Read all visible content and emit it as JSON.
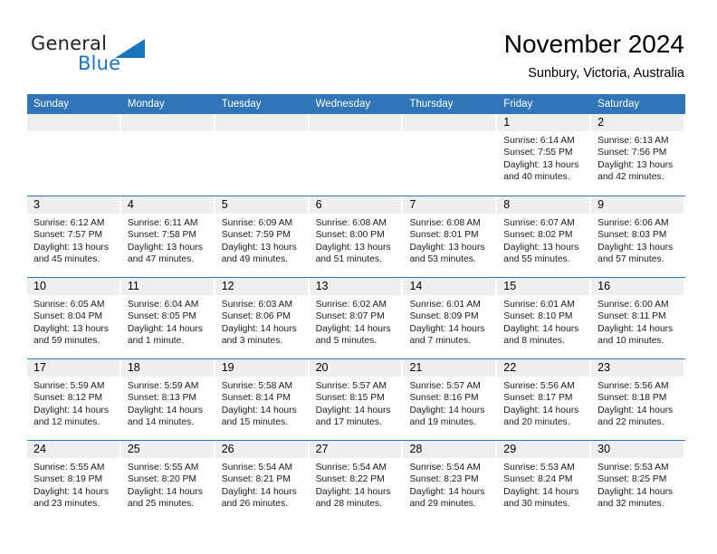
{
  "brand": {
    "name_part1": "General",
    "name_part2": "Blue",
    "accent_color": "#1b75bc",
    "triangle_icon": "triangle-icon"
  },
  "header": {
    "title": "November 2024",
    "subtitle": "Sunbury, Victoria, Australia"
  },
  "calendar": {
    "header_bg": "#3075b7",
    "daynum_bg": "#efefef",
    "weekdays": [
      "Sunday",
      "Monday",
      "Tuesday",
      "Wednesday",
      "Thursday",
      "Friday",
      "Saturday"
    ],
    "weeks": [
      [
        {
          "day": "",
          "lines": []
        },
        {
          "day": "",
          "lines": []
        },
        {
          "day": "",
          "lines": []
        },
        {
          "day": "",
          "lines": []
        },
        {
          "day": "",
          "lines": []
        },
        {
          "day": "1",
          "lines": [
            "Sunrise: 6:14 AM",
            "Sunset: 7:55 PM",
            "Daylight: 13 hours",
            "and 40 minutes."
          ]
        },
        {
          "day": "2",
          "lines": [
            "Sunrise: 6:13 AM",
            "Sunset: 7:56 PM",
            "Daylight: 13 hours",
            "and 42 minutes."
          ]
        }
      ],
      [
        {
          "day": "3",
          "lines": [
            "Sunrise: 6:12 AM",
            "Sunset: 7:57 PM",
            "Daylight: 13 hours",
            "and 45 minutes."
          ]
        },
        {
          "day": "4",
          "lines": [
            "Sunrise: 6:11 AM",
            "Sunset: 7:58 PM",
            "Daylight: 13 hours",
            "and 47 minutes."
          ]
        },
        {
          "day": "5",
          "lines": [
            "Sunrise: 6:09 AM",
            "Sunset: 7:59 PM",
            "Daylight: 13 hours",
            "and 49 minutes."
          ]
        },
        {
          "day": "6",
          "lines": [
            "Sunrise: 6:08 AM",
            "Sunset: 8:00 PM",
            "Daylight: 13 hours",
            "and 51 minutes."
          ]
        },
        {
          "day": "7",
          "lines": [
            "Sunrise: 6:08 AM",
            "Sunset: 8:01 PM",
            "Daylight: 13 hours",
            "and 53 minutes."
          ]
        },
        {
          "day": "8",
          "lines": [
            "Sunrise: 6:07 AM",
            "Sunset: 8:02 PM",
            "Daylight: 13 hours",
            "and 55 minutes."
          ]
        },
        {
          "day": "9",
          "lines": [
            "Sunrise: 6:06 AM",
            "Sunset: 8:03 PM",
            "Daylight: 13 hours",
            "and 57 minutes."
          ]
        }
      ],
      [
        {
          "day": "10",
          "lines": [
            "Sunrise: 6:05 AM",
            "Sunset: 8:04 PM",
            "Daylight: 13 hours",
            "and 59 minutes."
          ]
        },
        {
          "day": "11",
          "lines": [
            "Sunrise: 6:04 AM",
            "Sunset: 8:05 PM",
            "Daylight: 14 hours",
            "and 1 minute."
          ]
        },
        {
          "day": "12",
          "lines": [
            "Sunrise: 6:03 AM",
            "Sunset: 8:06 PM",
            "Daylight: 14 hours",
            "and 3 minutes."
          ]
        },
        {
          "day": "13",
          "lines": [
            "Sunrise: 6:02 AM",
            "Sunset: 8:07 PM",
            "Daylight: 14 hours",
            "and 5 minutes."
          ]
        },
        {
          "day": "14",
          "lines": [
            "Sunrise: 6:01 AM",
            "Sunset: 8:09 PM",
            "Daylight: 14 hours",
            "and 7 minutes."
          ]
        },
        {
          "day": "15",
          "lines": [
            "Sunrise: 6:01 AM",
            "Sunset: 8:10 PM",
            "Daylight: 14 hours",
            "and 8 minutes."
          ]
        },
        {
          "day": "16",
          "lines": [
            "Sunrise: 6:00 AM",
            "Sunset: 8:11 PM",
            "Daylight: 14 hours",
            "and 10 minutes."
          ]
        }
      ],
      [
        {
          "day": "17",
          "lines": [
            "Sunrise: 5:59 AM",
            "Sunset: 8:12 PM",
            "Daylight: 14 hours",
            "and 12 minutes."
          ]
        },
        {
          "day": "18",
          "lines": [
            "Sunrise: 5:59 AM",
            "Sunset: 8:13 PM",
            "Daylight: 14 hours",
            "and 14 minutes."
          ]
        },
        {
          "day": "19",
          "lines": [
            "Sunrise: 5:58 AM",
            "Sunset: 8:14 PM",
            "Daylight: 14 hours",
            "and 15 minutes."
          ]
        },
        {
          "day": "20",
          "lines": [
            "Sunrise: 5:57 AM",
            "Sunset: 8:15 PM",
            "Daylight: 14 hours",
            "and 17 minutes."
          ]
        },
        {
          "day": "21",
          "lines": [
            "Sunrise: 5:57 AM",
            "Sunset: 8:16 PM",
            "Daylight: 14 hours",
            "and 19 minutes."
          ]
        },
        {
          "day": "22",
          "lines": [
            "Sunrise: 5:56 AM",
            "Sunset: 8:17 PM",
            "Daylight: 14 hours",
            "and 20 minutes."
          ]
        },
        {
          "day": "23",
          "lines": [
            "Sunrise: 5:56 AM",
            "Sunset: 8:18 PM",
            "Daylight: 14 hours",
            "and 22 minutes."
          ]
        }
      ],
      [
        {
          "day": "24",
          "lines": [
            "Sunrise: 5:55 AM",
            "Sunset: 8:19 PM",
            "Daylight: 14 hours",
            "and 23 minutes."
          ]
        },
        {
          "day": "25",
          "lines": [
            "Sunrise: 5:55 AM",
            "Sunset: 8:20 PM",
            "Daylight: 14 hours",
            "and 25 minutes."
          ]
        },
        {
          "day": "26",
          "lines": [
            "Sunrise: 5:54 AM",
            "Sunset: 8:21 PM",
            "Daylight: 14 hours",
            "and 26 minutes."
          ]
        },
        {
          "day": "27",
          "lines": [
            "Sunrise: 5:54 AM",
            "Sunset: 8:22 PM",
            "Daylight: 14 hours",
            "and 28 minutes."
          ]
        },
        {
          "day": "28",
          "lines": [
            "Sunrise: 5:54 AM",
            "Sunset: 8:23 PM",
            "Daylight: 14 hours",
            "and 29 minutes."
          ]
        },
        {
          "day": "29",
          "lines": [
            "Sunrise: 5:53 AM",
            "Sunset: 8:24 PM",
            "Daylight: 14 hours",
            "and 30 minutes."
          ]
        },
        {
          "day": "30",
          "lines": [
            "Sunrise: 5:53 AM",
            "Sunset: 8:25 PM",
            "Daylight: 14 hours",
            "and 32 minutes."
          ]
        }
      ]
    ]
  }
}
